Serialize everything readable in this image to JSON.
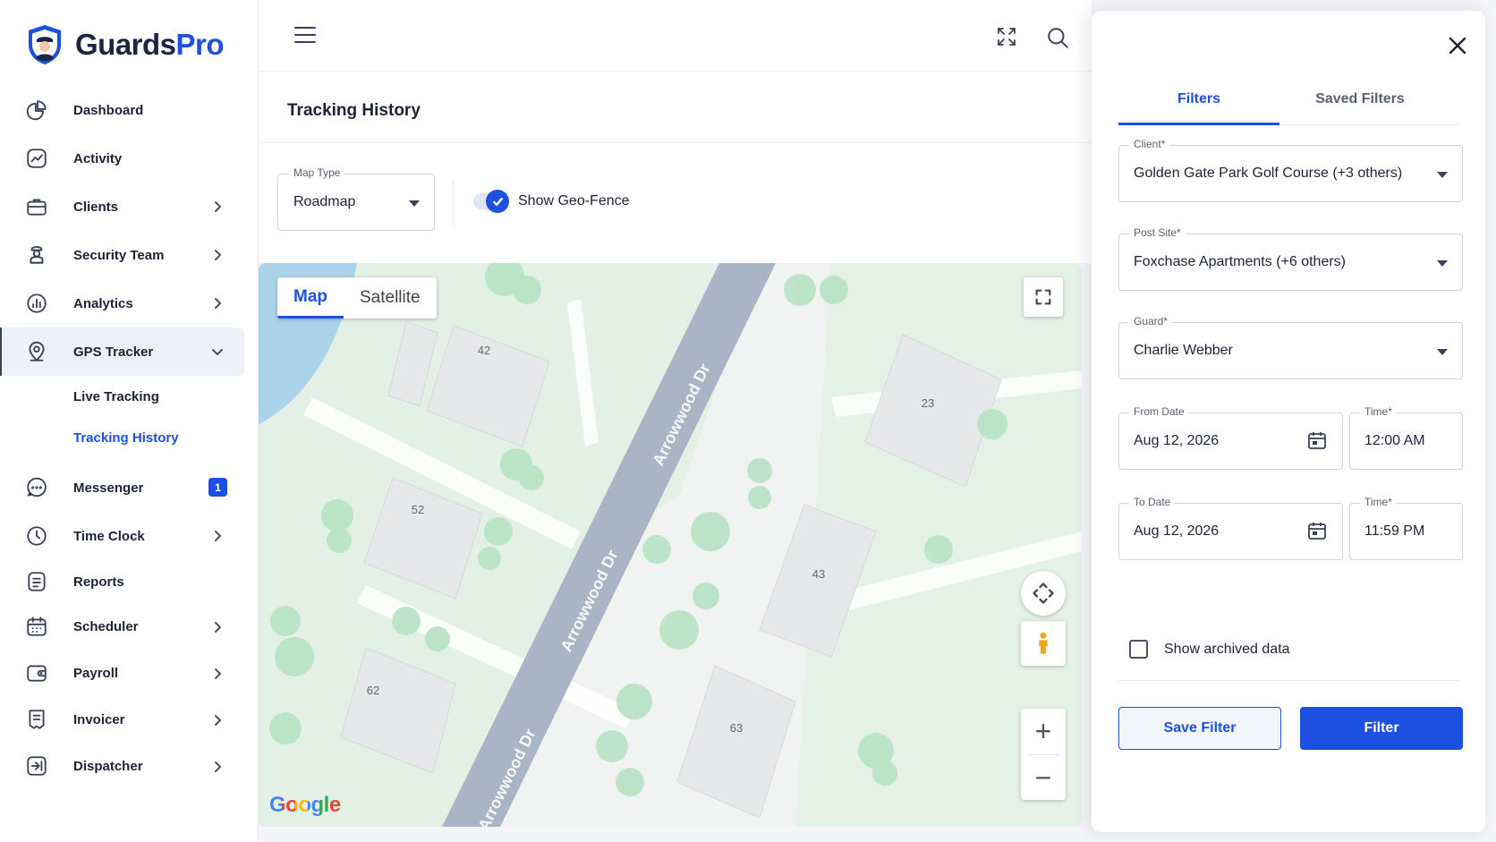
{
  "brand": {
    "part1": "Guards",
    "part2": "Pro"
  },
  "sidebar": {
    "items": [
      {
        "label": "Dashboard",
        "icon": "pie-chart-icon",
        "chevron": false
      },
      {
        "label": "Activity",
        "icon": "activity-chart-icon",
        "chevron": false
      },
      {
        "label": "Clients",
        "icon": "briefcase-icon",
        "chevron": true
      },
      {
        "label": "Security Team",
        "icon": "guard-icon",
        "chevron": true
      },
      {
        "label": "Analytics",
        "icon": "bar-chart-icon",
        "chevron": true
      },
      {
        "label": "GPS Tracker",
        "icon": "location-pin-icon",
        "chevron": true,
        "expanded": true
      },
      {
        "label": "Messenger",
        "icon": "chat-icon",
        "badge": "1"
      },
      {
        "label": "Time Clock",
        "icon": "clock-icon",
        "chevron": true
      },
      {
        "label": "Reports",
        "icon": "document-icon",
        "chevron": false
      },
      {
        "label": "Scheduler",
        "icon": "calendar-icon",
        "chevron": true
      },
      {
        "label": "Payroll",
        "icon": "wallet-icon",
        "chevron": true
      },
      {
        "label": "Invoicer",
        "icon": "invoice-icon",
        "chevron": true
      },
      {
        "label": "Dispatcher",
        "icon": "dispatch-icon",
        "chevron": true
      }
    ],
    "gps_sub": [
      "Live Tracking",
      "Tracking History"
    ]
  },
  "page": {
    "title": "Tracking History"
  },
  "controls": {
    "map_type_label": "Map Type",
    "map_type_value": "Roadmap",
    "geofence_label": "Show Geo-Fence",
    "geofence_on": true
  },
  "map": {
    "toggle": [
      "Map",
      "Satellite"
    ],
    "street": "Arrowwood Dr",
    "lots": [
      "42",
      "52",
      "62",
      "23",
      "43",
      "63"
    ],
    "attribution": "Google",
    "zoom_in": "+",
    "zoom_out": "−"
  },
  "drawer": {
    "tabs": [
      "Filters",
      "Saved Filters"
    ],
    "client_label": "Client*",
    "client_value": "Golden Gate Park Golf Course (+3 others)",
    "post_site_label": "Post Site*",
    "post_site_value": "Foxchase Apartments (+6 others)",
    "guard_label": "Guard*",
    "guard_value": "Charlie Webber",
    "from_date_label": "From Date",
    "from_date_value": "Aug 12, 2026",
    "from_time_label": "Time*",
    "from_time_value": "12:00 AM",
    "to_date_label": "To Date",
    "to_date_value": "Aug 12, 2026",
    "to_time_label": "Time*",
    "to_time_value": "11:59 PM",
    "archived_label": "Show archived data",
    "save_label": "Save Filter",
    "filter_label": "Filter"
  },
  "colors": {
    "accent": "#1d4fe0",
    "road": "#a9b4c4",
    "park": "#d7eedd",
    "water": "#aad3ea"
  }
}
